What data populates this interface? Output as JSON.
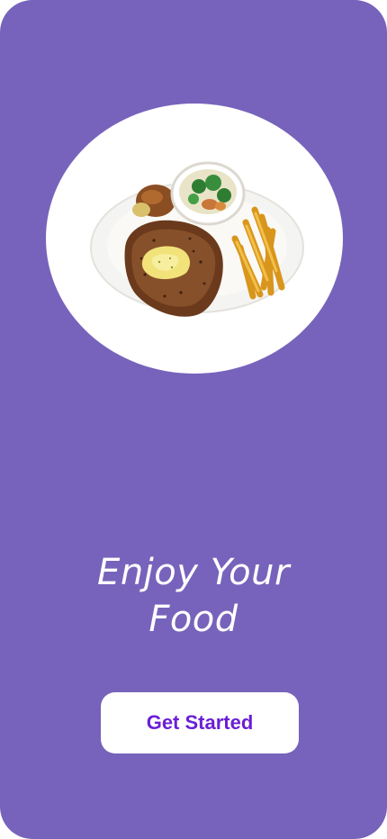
{
  "onboarding": {
    "hero_image": "steak-plate-with-fries-and-vegetables",
    "headline_line1": "Enjoy Your",
    "headline_line2": "Food",
    "cta_label": "Get Started"
  },
  "colors": {
    "background": "#7763bb",
    "cta_text": "#6a1fd6",
    "cta_background": "#ffffff",
    "headline": "#ffffff"
  }
}
